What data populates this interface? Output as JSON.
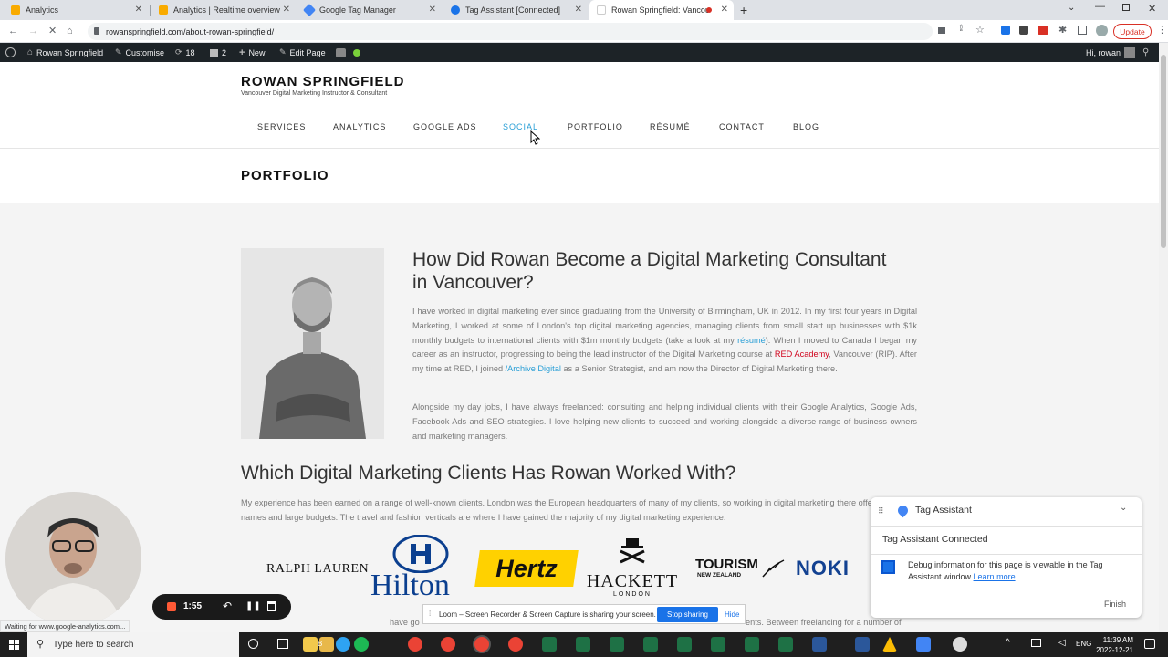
{
  "browser": {
    "tabs": [
      {
        "title": "Analytics",
        "color": "#f9ab00"
      },
      {
        "title": "Analytics | Realtime overview",
        "color": "#f9ab00"
      },
      {
        "title": "Google Tag Manager",
        "color": "#4285f4"
      },
      {
        "title": "Tag Assistant [Connected]",
        "color": "#1a73e8"
      },
      {
        "title": "Rowan Springfield: Vancouv",
        "color": "#ffffff"
      }
    ],
    "new_tab": "+",
    "url": "rowanspringfield.com/about-rowan-springfield/",
    "update_label": "Update"
  },
  "wp_admin": {
    "site": "Rowan Springfield",
    "customise": "Customise",
    "updates": "18",
    "comments": "2",
    "new": "New",
    "edit": "Edit Page",
    "greeting": "Hi, rowan"
  },
  "site": {
    "title": "ROWAN SPRINGFIELD",
    "tagline": "Vancouver Digital Marketing Instructor & Consultant",
    "nav": [
      "SERVICES",
      "ANALYTICS",
      "GOOGLE ADS",
      "SOCIAL",
      "PORTFOLIO",
      "RÉSUMÉ",
      "CONTACT",
      "BLOG"
    ],
    "page_title": "PORTFOLIO"
  },
  "article": {
    "heading": "How Did Rowan Become a Digital Marketing Consultant in Vancouver?",
    "p1_a": "I have worked in digital marketing ever since graduating from the University of Birmingham, UK in 2012. In my first four years in Digital Marketing, I worked at some of London's top digital marketing agencies, managing clients from small start up businesses with $1k monthly budgets to international clients with $1m monthly budgets (take a look at my ",
    "p1_link1": "résumé",
    "p1_b": "). When I moved to Canada I began my career as an instructor, progressing to being the lead instructor of the Digital Marketing course at ",
    "p1_link2": "RED Academy",
    "p1_c": ", Vancouver (RIP). After my time at RED, I joined ",
    "p1_link3": "/Archive Digital",
    "p1_d": " as a Senior Strategist, and am now the Director of Digital Marketing there.",
    "p2": "Alongside my day jobs, I have always freelanced: consulting and helping individual clients with their Google Analytics, Google Ads, Facebook Ads and SEO strategies. I love helping new clients to succeed and working alongside a diverse range of business owners and marketing managers.",
    "heading2": "Which Digital Marketing Clients Has Rowan Worked With?",
    "p3": "My experience has been earned on a range of well-known clients. London was the European headquarters of many of my clients, so working in digital marketing there offered big names and large budgets. The travel and fashion verticals are where I have gained the majority of my digital marketing experience:",
    "p4_left": "have go",
    "p4_right": "ents. Between freelancing for a number of"
  },
  "logos": {
    "ralph": "RALPH LAUREN",
    "hilton": "Hilton",
    "hertz": "Hertz",
    "hackett": "HACKETT",
    "hackett_sub": "LONDON",
    "tourism": "TOURISM",
    "tourism_sub": "NEW ZEALAND",
    "nokia": "NOKI"
  },
  "tag_assistant": {
    "title": "Tag Assistant",
    "connected": "Tag Assistant Connected",
    "debug": "Debug information for this page is viewable in the Tag Assistant window",
    "learn_more": "Learn more",
    "finish": "Finish"
  },
  "loom": {
    "time": "1:55",
    "share_text": "Loom – Screen Recorder & Screen Capture is sharing your screen.",
    "stop": "Stop sharing",
    "hide": "Hide"
  },
  "status_text": "Waiting for www.google-analytics.com...",
  "taskbar": {
    "search": "Type here to search",
    "lang": "ENG",
    "time": "11:39 AM",
    "date": "2022-12-21"
  }
}
